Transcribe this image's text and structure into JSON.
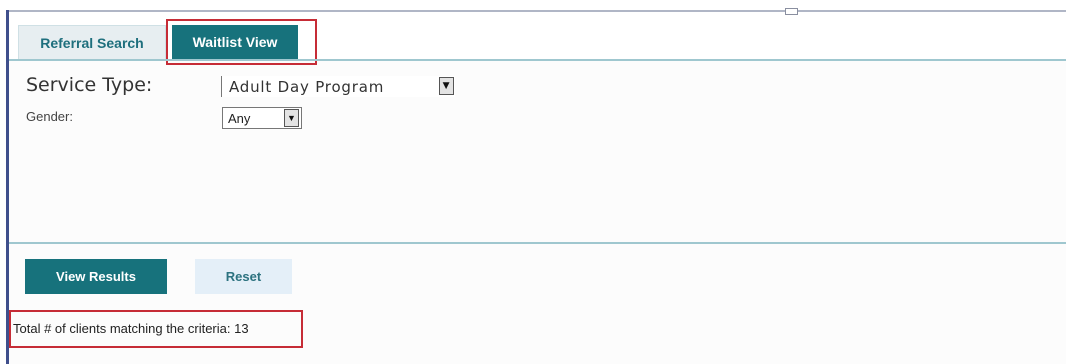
{
  "tabs": {
    "referral_search": "Referral Search",
    "waitlist_view": "Waitlist View"
  },
  "form": {
    "service_type_label": "Service Type:",
    "service_type_value": "Adult Day Program",
    "gender_label": "Gender:",
    "gender_value": "Any"
  },
  "buttons": {
    "view_results": "View Results",
    "reset": "Reset"
  },
  "results": {
    "summary_text": "Total # of clients matching the criteria: 13",
    "count": 13
  },
  "icons": {
    "dropdown_arrow": "chevron-down-icon",
    "dropdown_glyph": "▼"
  },
  "colors": {
    "accent_teal": "#17727c",
    "tab_inactive_bg": "#e7eef1",
    "reset_bg": "#e4eff8",
    "highlight_red": "#c62c36",
    "divider": "#9fc7cf"
  }
}
